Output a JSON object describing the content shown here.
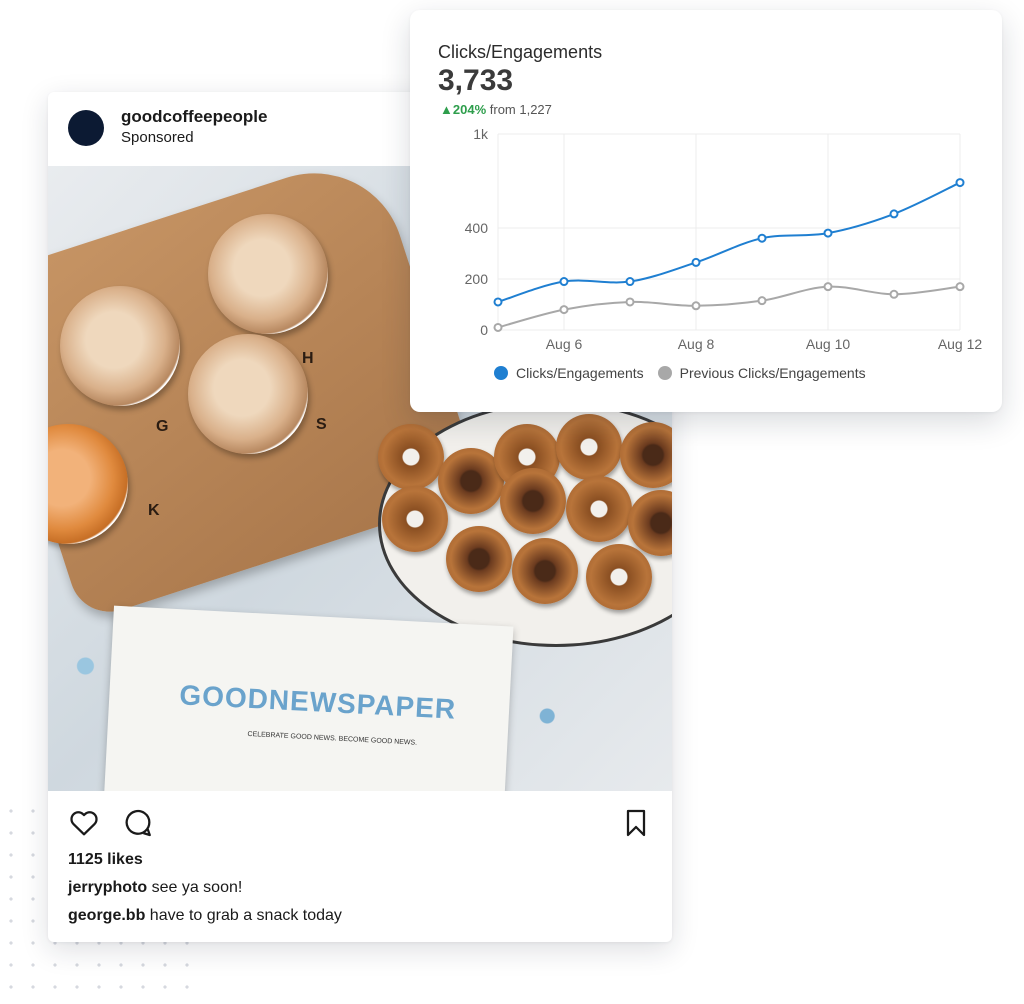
{
  "post": {
    "username": "goodcoffeepeople",
    "label": "Sponsored",
    "photo": {
      "board_letters": [
        "G",
        "H",
        "S",
        "K"
      ],
      "newspaper_title": "GOODNEWSPAPER",
      "newspaper_subtitle": "CELEBRATE GOOD NEWS. BECOME GOOD NEWS."
    },
    "likes": "1125 likes",
    "comments": [
      {
        "user": "jerryphoto",
        "text": "see ya soon!"
      },
      {
        "user": "george.bb",
        "text": "have to grab a snack today"
      }
    ],
    "icons": {
      "like": "heart-icon",
      "comment": "comment-icon",
      "save": "bookmark-icon"
    }
  },
  "analytics": {
    "title": "Clicks/Engagements",
    "value": "3,733",
    "change_pct": "204%",
    "change_from": "from 1,227",
    "colors": {
      "current": "#1f7fd1",
      "previous": "#a8a8a8",
      "up": "#2e9e4c"
    }
  },
  "chart_data": {
    "type": "line",
    "x": [
      "Aug 5",
      "Aug 6",
      "Aug 7",
      "Aug 8",
      "Aug 9",
      "Aug 10",
      "Aug 11",
      "Aug 12"
    ],
    "tick_labels_x": [
      "Aug 6",
      "Aug 8",
      "Aug 10",
      "Aug 12"
    ],
    "tick_labels_y": [
      "0",
      "200",
      "400",
      "1k"
    ],
    "series": [
      {
        "name": "Clicks/Engagements",
        "values": [
          110,
          190,
          190,
          265,
          360,
          380,
          490,
          690
        ]
      },
      {
        "name": "Previous Clicks/Engagements",
        "values": [
          10,
          80,
          110,
          95,
          115,
          170,
          140,
          170
        ]
      }
    ],
    "grid": true,
    "legend_position": "bottom"
  }
}
